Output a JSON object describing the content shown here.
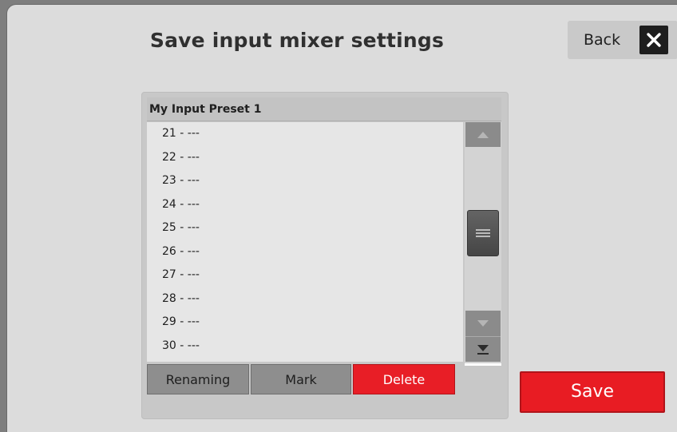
{
  "window": {
    "title": "Save input mixer settings"
  },
  "header": {
    "back_label": "Back",
    "close_icon": "close-icon"
  },
  "preset_list": {
    "header": "My Input Preset 1",
    "items": [
      {
        "label": "21 - ---"
      },
      {
        "label": "22 - ---"
      },
      {
        "label": "23 - ---"
      },
      {
        "label": "24 - ---"
      },
      {
        "label": "25 - ---"
      },
      {
        "label": "26 - ---"
      },
      {
        "label": "27 - ---"
      },
      {
        "label": "28 - ---"
      },
      {
        "label": "29 - ---"
      },
      {
        "label": "30 - ---"
      }
    ]
  },
  "actions": {
    "rename_label": "Renaming",
    "mark_label": "Mark",
    "delete_label": "Delete"
  },
  "footer": {
    "save_label": "Save"
  },
  "colors": {
    "accent_red": "#e81e26",
    "panel_bg": "#dcdcdc",
    "list_bg": "#e6e6e6"
  }
}
